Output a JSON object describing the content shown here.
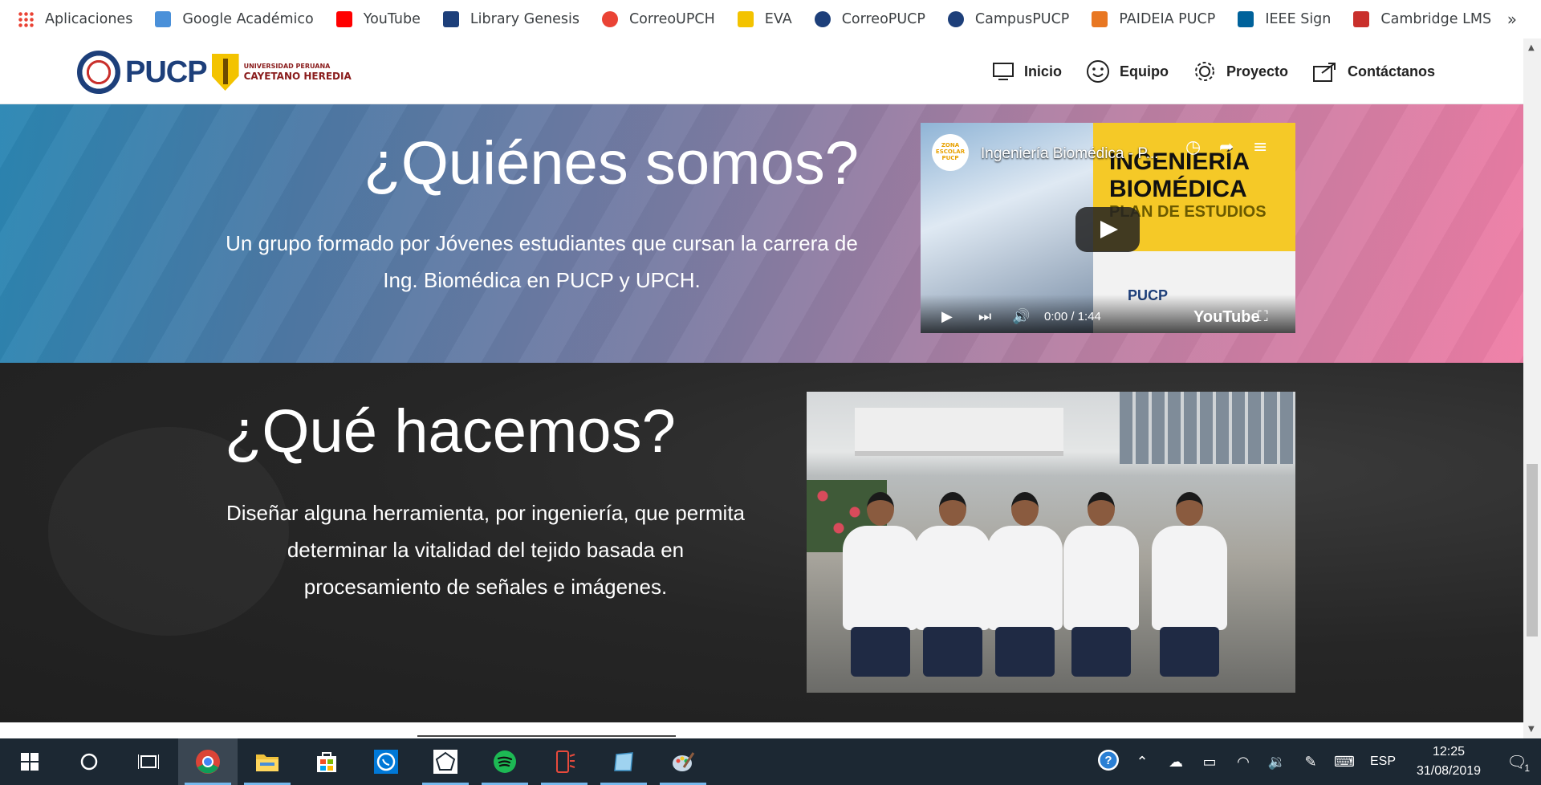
{
  "bookmarks": [
    {
      "label": "Aplicaciones",
      "icon": "apps-grid-icon"
    },
    {
      "label": "Google Académico",
      "icon": "google-scholar-icon"
    },
    {
      "label": "YouTube",
      "icon": "youtube-icon"
    },
    {
      "label": "Library Genesis",
      "icon": "library-genesis-icon"
    },
    {
      "label": "CorreoUPCH",
      "icon": "google-icon"
    },
    {
      "label": "EVA",
      "icon": "upch-shield-icon"
    },
    {
      "label": "CorreoPUCP",
      "icon": "pucp-seal-icon"
    },
    {
      "label": "CampusPUCP",
      "icon": "pucp-seal-icon"
    },
    {
      "label": "PAIDEIA PUCP",
      "icon": "paideia-icon"
    },
    {
      "label": "IEEE Sign",
      "icon": "ieee-icon"
    },
    {
      "label": "Cambridge LMS",
      "icon": "cambridge-icon"
    }
  ],
  "bookmarks_more": "»",
  "site": {
    "logo": {
      "pucp": "PUCP",
      "upch_small": "UNIVERSIDAD PERUANA",
      "upch_big": "CAYETANO HEREDIA"
    },
    "nav": [
      {
        "label": "Inicio",
        "icon": "monitor-icon"
      },
      {
        "label": "Equipo",
        "icon": "smiley-icon"
      },
      {
        "label": "Proyecto",
        "icon": "gear-icon"
      },
      {
        "label": "Contáctanos",
        "icon": "share-icon"
      }
    ]
  },
  "section_who": {
    "title": "¿Quiénes somos?",
    "text": "Un grupo formado por Jóvenes estudiantes que cursan la carrera de Ing. Biomédica en PUCP y UPCH."
  },
  "video": {
    "title": "Ingeniería Biomédica - P...",
    "channel": "ZONA ESCOLAR PUCP",
    "overlay_line1": "INGENIERÍA",
    "overlay_line2": "BIOMÉDICA",
    "overlay_line3": "PLAN DE ESTUDIOS",
    "pucp": "PUCP",
    "time": "0:00 / 1:44",
    "brand": "YouTube"
  },
  "section_what": {
    "title": "¿Qué hacemos?",
    "text": "Diseñar alguna herramienta, por ingeniería, que permita determinar la vitalidad del tejido basada en procesamiento de señales e imágenes."
  },
  "taskbar": {
    "apps": [
      {
        "name": "start-button",
        "icon": "windows-icon"
      },
      {
        "name": "cortana-button",
        "icon": "search-circle-icon"
      },
      {
        "name": "task-view-button",
        "icon": "task-view-icon"
      },
      {
        "name": "chrome-app",
        "icon": "chrome-icon"
      },
      {
        "name": "file-explorer-app",
        "icon": "folder-icon"
      },
      {
        "name": "store-app",
        "icon": "store-icon"
      },
      {
        "name": "whatsapp-app",
        "icon": "whatsapp-icon"
      },
      {
        "name": "app-unknown",
        "icon": "app-icon"
      },
      {
        "name": "spotify-app",
        "icon": "spotify-icon"
      },
      {
        "name": "phone-app",
        "icon": "phone-icon"
      },
      {
        "name": "notes-app",
        "icon": "notes-icon"
      },
      {
        "name": "paint-app",
        "icon": "paint-icon"
      }
    ],
    "lang": "ESP",
    "time": "12:25",
    "date": "31/08/2019",
    "notifications": "1"
  },
  "colors": {
    "gradient_start": "#2b87b4",
    "gradient_end": "#f07ea6",
    "dark_section": "#262626",
    "taskbar": "#1c2833",
    "pucp_blue": "#1d3f7a",
    "upch_gold": "#f3c300"
  }
}
